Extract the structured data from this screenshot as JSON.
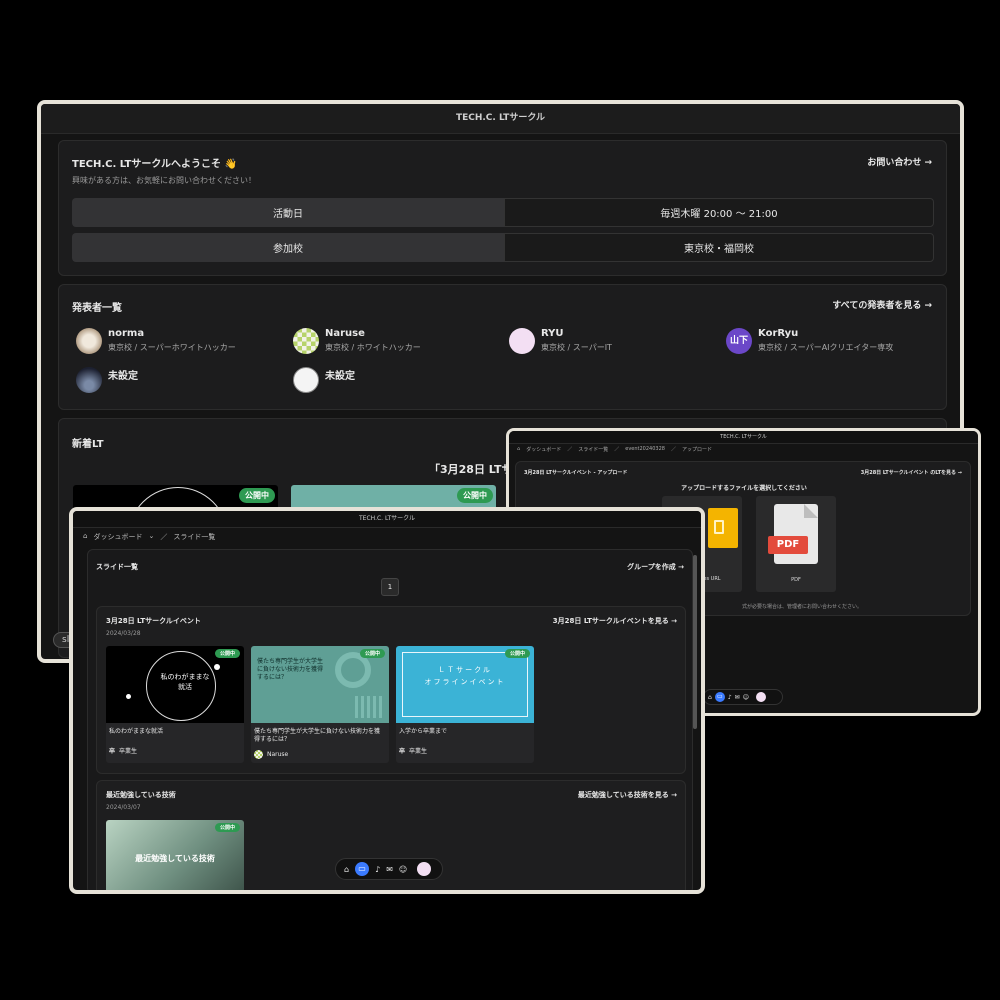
{
  "main": {
    "title": "TECH.C. LTサークル",
    "welcome": "TECH.C. LTサークルへようこそ 👋",
    "welcome_sub": "興味がある方は、お気軽にお問い合わせください！",
    "contact": "お問い合わせ →",
    "info": [
      {
        "key": "活動日",
        "value": "毎週木曜 20:00 〜 21:00"
      },
      {
        "key": "参加校",
        "value": "東京校・福岡校"
      }
    ],
    "presenters_title": "発表者一覧",
    "presenters_all": "すべての発表者を見る →",
    "presenters": [
      {
        "name": "norma",
        "sub": "東京校 / スーパーホワイトハッカー"
      },
      {
        "name": "Naruse",
        "sub": "東京校 / ホワイトハッカー"
      },
      {
        "name": "RYU",
        "sub": "東京校 / スーパーIT"
      },
      {
        "name": "KorRyu",
        "sub": "東京校 / スーパーAIクリエイター専攻",
        "avatar_text": "山下"
      },
      {
        "name": "未設定",
        "sub": ""
      },
      {
        "name": "未設定",
        "sub": ""
      }
    ],
    "new_lt": "新着LT",
    "event_heading": "「3月28日 LTサー",
    "badge": "公開中",
    "slides_label": "slid"
  },
  "upload": {
    "title": "TECH.C. LTサークル",
    "breadcrumb": [
      "ダッシュボード",
      "スライド一覧",
      "event20240328",
      "アップロード"
    ],
    "heading": "3月28日 LTサークルイベント - アップロード",
    "back_link": "3月28日 LTサークルイベント のLTを見る →",
    "prompt": "アップロードするファイルを選択してください",
    "options": [
      {
        "label": "Google Slides URL",
        "visible_label": "les URL"
      },
      {
        "label": "PDF",
        "badge": "PDF"
      }
    ],
    "note": "式が必要な場合は、管理者にお問い合わせください。"
  },
  "slides": {
    "title": "TECH.C. LTサークル",
    "breadcrumb": [
      "ダッシュボード",
      "スライド一覧"
    ],
    "heading": "スライド一覧",
    "create_group": "グループを作成 →",
    "page": "1",
    "groups": [
      {
        "name": "3月28日 LTサークルイベント",
        "date": "2024/03/28",
        "link": "3月28日 LTサークルイベントを見る →",
        "items": [
          {
            "title": "私のわがままな就活",
            "author": "卒業生",
            "author_icon": "卒",
            "thumb_text": "私のわがままな\n就活"
          },
          {
            "title": "僕たち専門学生が大学生に負けない技術力を獲得するには？",
            "author": "Naruse",
            "author_icon": "",
            "thumb_text": "僕たち専門学生が大学生\nに負けない技術力を獲得\nするには？"
          },
          {
            "title": "入学から卒業まで",
            "author": "卒業生",
            "author_icon": "卒",
            "thumb_text": "ＬＴサークル\nオフラインイベント"
          }
        ]
      },
      {
        "name": "最近勉強している技術",
        "date": "2024/03/07",
        "link": "最近勉強している技術を見る →",
        "items": [
          {
            "title": "",
            "author": "",
            "thumb_text": "最近勉強している技術"
          }
        ]
      }
    ],
    "badge": "公開中"
  },
  "colors": {
    "accent_green": "#2e9a52",
    "accent_blue": "#3b7bff",
    "teal": "#5ab3a8",
    "cyan": "#38b6d8"
  }
}
